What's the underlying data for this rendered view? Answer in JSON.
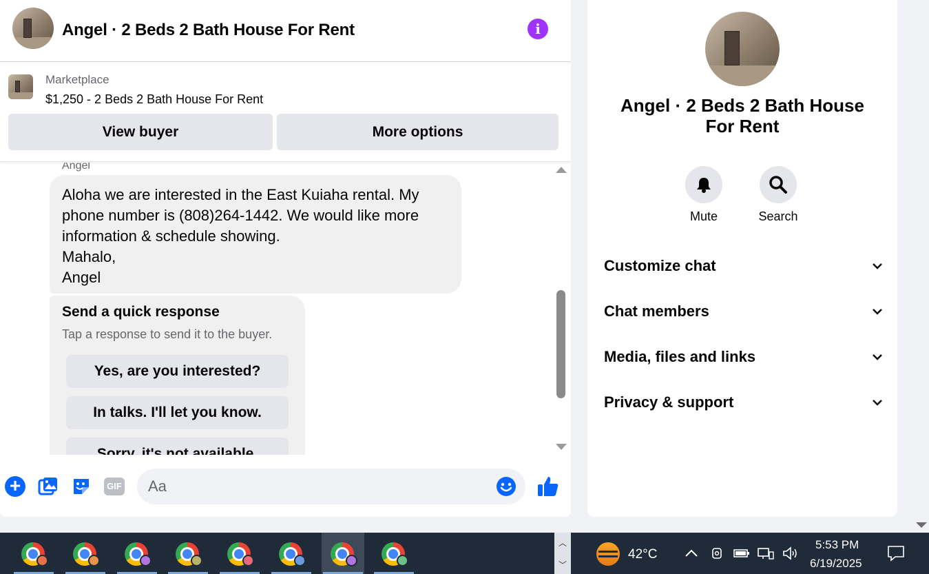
{
  "header": {
    "title": "Angel · 2 Beds 2 Bath House For Rent",
    "info_icon": "i"
  },
  "listing": {
    "label": "Marketplace",
    "price_title": "$1,250 - 2 Beds 2 Bath House For Rent",
    "view_buyer": "View buyer",
    "more_options": "More options"
  },
  "messages": {
    "sender": "Angel",
    "lines": [
      "Aloha we are interested in the East Kuiaha rental. My",
      "phone number is (808)264-1442. We would like more",
      "information & schedule showing.",
      "Mahalo,",
      "Angel"
    ],
    "quick_title": "Send a quick response",
    "quick_subtitle": "Tap a response to send it to the buyer.",
    "quick_options": [
      "Yes, are you interested?",
      "In talks. I'll let you know.",
      "Sorry, it's not available."
    ]
  },
  "composer": {
    "placeholder": "Aa",
    "gif_label": "GIF",
    "plus_label": "+"
  },
  "side": {
    "title_line1": "Angel · 2 Beds 2 Bath House",
    "title_line2": "For Rent",
    "mute": "Mute",
    "search": "Search",
    "sections": [
      "Customize chat",
      "Chat members",
      "Media, files and links",
      "Privacy & support"
    ]
  },
  "taskbar": {
    "temperature": "42°C",
    "time": "5:53 PM",
    "date": "6/19/2025",
    "profile_badge_colors": [
      "#e8714a",
      "#e8954a",
      "#b276e0",
      "#b9b36a",
      "#e86a7a",
      "#6a9be0",
      "#b276e0",
      "#6fbf8a"
    ]
  },
  "colors": {
    "accent": "#0866ff",
    "info": "#a033ff",
    "bubble": "#f0f0f0"
  }
}
